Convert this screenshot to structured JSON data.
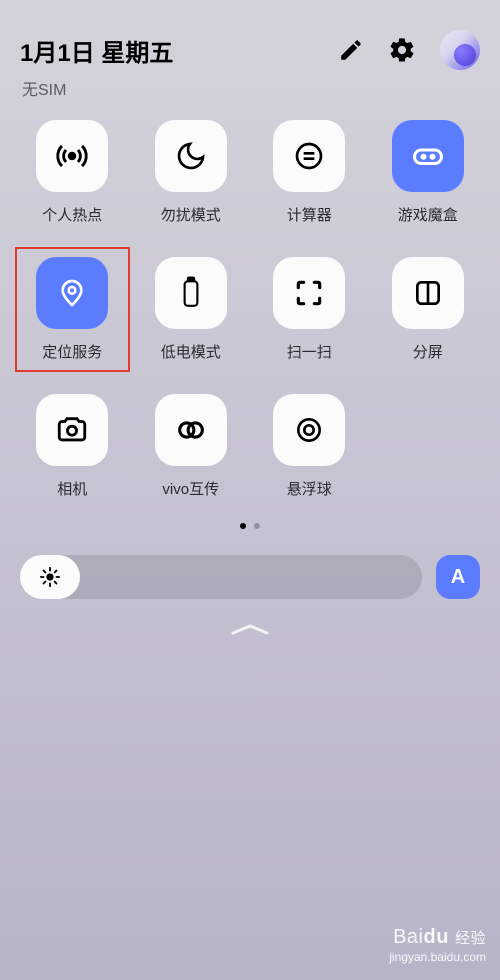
{
  "header": {
    "date": "1月1日 星期五",
    "sim": "无SIM"
  },
  "tiles": [
    {
      "id": "hotspot",
      "label": "个人热点",
      "active": false
    },
    {
      "id": "dnd",
      "label": "勿扰模式",
      "active": false
    },
    {
      "id": "calc",
      "label": "计算器",
      "active": false
    },
    {
      "id": "gamebox",
      "label": "游戏魔盒",
      "active": true
    },
    {
      "id": "location",
      "label": "定位服务",
      "active": true,
      "highlight": true
    },
    {
      "id": "lowbatt",
      "label": "低电模式",
      "active": false
    },
    {
      "id": "scan",
      "label": "扫一扫",
      "active": false
    },
    {
      "id": "split",
      "label": "分屏",
      "active": false
    },
    {
      "id": "camera",
      "label": "相机",
      "active": false
    },
    {
      "id": "vivoshare",
      "label": "vivo互传",
      "active": false
    },
    {
      "id": "floatball",
      "label": "悬浮球",
      "active": false
    }
  ],
  "brightness": {
    "auto_label": "A"
  },
  "watermark": {
    "logo_a": "Bai",
    "logo_b": "du",
    "suffix": "经验",
    "url": "jingyan.baidu.com"
  }
}
